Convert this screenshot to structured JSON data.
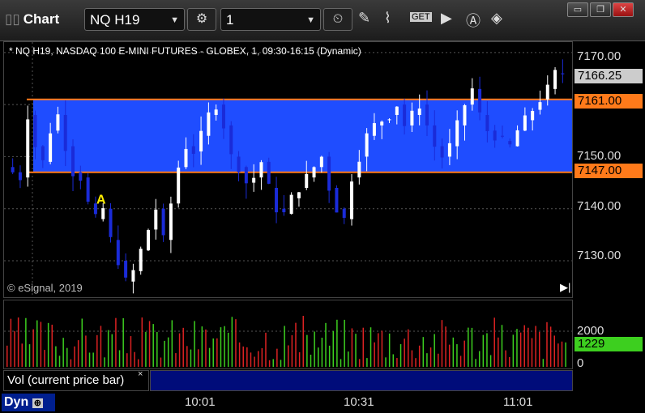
{
  "window": {
    "title": "Chart",
    "symbol": "NQ H19",
    "interval": "1",
    "min_icon": "minimize-icon",
    "restore_icon": "restore-icon",
    "close_icon": "close-icon"
  },
  "toolbar": {
    "icons": [
      "gear-icon",
      "clock-icon",
      "pencil-icon",
      "indicator-icon",
      "get-icon",
      "play-icon",
      "alert-icon",
      "diamond-icon"
    ],
    "get_label": "GET"
  },
  "chart": {
    "header": "* NQ H19, NASDAQ 100 E-MINI FUTURES - GLOBEX, 1, 09:30-16:15 (Dynamic)",
    "copyright": "© eSignal, 2019",
    "annotation": "A",
    "yticks": [
      "7170.00",
      "7150.00",
      "7140.00",
      "7130.00"
    ],
    "price_tag": "7166.25",
    "upper_line_tag": "7161.00",
    "lower_line_tag": "7147.00",
    "colors": {
      "band": "#1f4dff",
      "line": "#ff7a1a",
      "up": "#ffffff",
      "down": "#1a2bd8",
      "annotation": "#ffee00"
    }
  },
  "chart_data": {
    "type": "bar",
    "xlabel": "",
    "ylabel": "",
    "ylim": [
      7123,
      7172
    ],
    "reference_lines": [
      7161.0,
      7147.0
    ],
    "bars_note": "",
    "volume_current": "1229",
    "volume_tick": "2000",
    "volume_zero": "0"
  },
  "volume": {
    "label": "Vol (current price bar)",
    "close_x": "×",
    "current": "1229",
    "tick_2000": "2000",
    "tick_0": "0"
  },
  "xaxis": {
    "ticks": [
      "10:01",
      "10:31",
      "11:01"
    ],
    "dyn_label": "Dyn"
  }
}
